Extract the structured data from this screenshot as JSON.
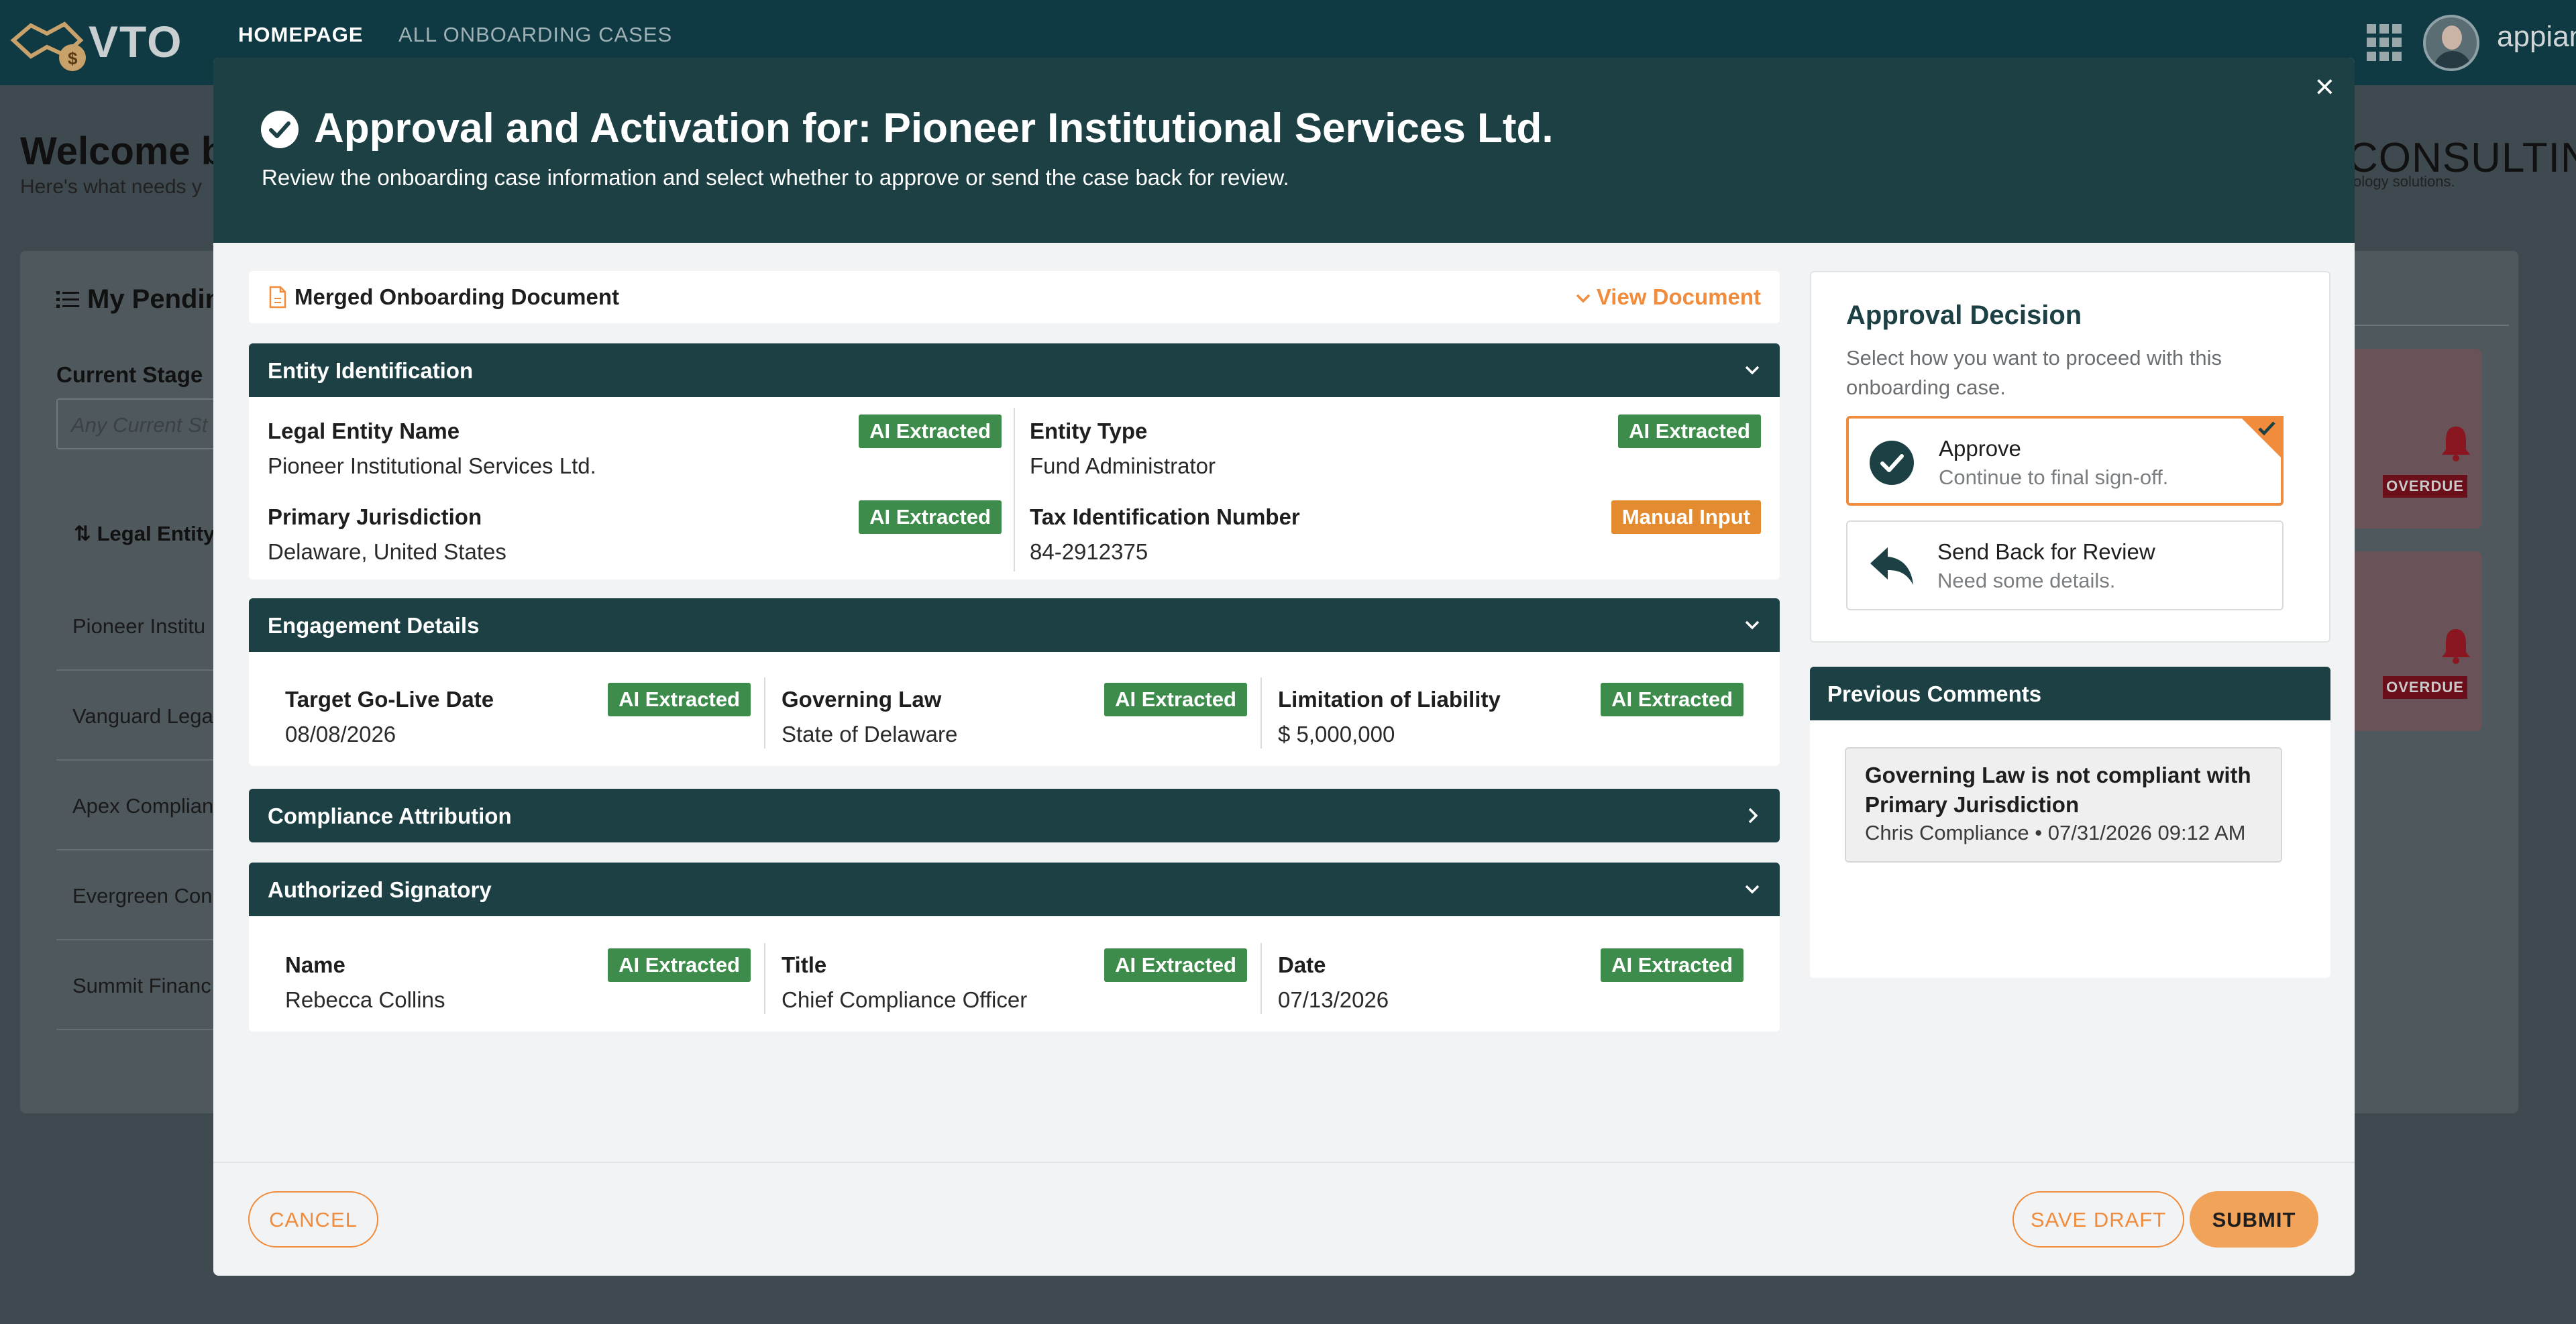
{
  "app": {
    "logo_text": "VTO",
    "nav": {
      "home": "HOMEPAGE",
      "cases": "ALL ONBOARDING CASES"
    },
    "brand": "appian"
  },
  "background_page": {
    "welcome": "Welcome b",
    "subtitle": "Here's what needs y",
    "consulting": "CONSULTING",
    "tagline": "ology solutions.",
    "pending_title": "My Pendin",
    "current_stage_label": "Current Stage",
    "current_stage_placeholder": "Any Current St",
    "column_header": "Legal Entity",
    "rows": [
      "Pioneer Institu",
      "Vanguard Lega",
      "Apex Complian",
      "Evergreen Con",
      "Summit Financ"
    ],
    "overdue_label": "OVERDUE"
  },
  "modal": {
    "close": "×",
    "title": "Approval and Activation for: Pioneer Institutional Services Ltd.",
    "subtitle": "Review the onboarding case information and select whether to approve or send the case back for review.",
    "document": {
      "title": "Merged Onboarding Document",
      "view_label": "View Document"
    },
    "tags": {
      "ai": "AI Extracted",
      "manual": "Manual Input"
    },
    "entity_identification": {
      "title": "Entity Identification",
      "fields": [
        {
          "label": "Legal Entity Name",
          "value": "Pioneer Institutional Services Ltd.",
          "tag": "AI Extracted"
        },
        {
          "label": "Entity Type",
          "value": "Fund Administrator",
          "tag": "AI Extracted"
        },
        {
          "label": "Primary Jurisdiction",
          "value": "Delaware, United States",
          "tag": "AI Extracted"
        },
        {
          "label": "Tax Identification Number",
          "value": "84-2912375",
          "tag": "Manual Input"
        }
      ]
    },
    "engagement_details": {
      "title": "Engagement Details",
      "fields": [
        {
          "label": "Target Go-Live Date",
          "value": "08/08/2026",
          "tag": "AI Extracted"
        },
        {
          "label": "Governing Law",
          "value": "State of Delaware",
          "tag": "AI Extracted"
        },
        {
          "label": "Limitation of Liability",
          "value": "$ 5,000,000",
          "tag": "AI Extracted"
        }
      ]
    },
    "compliance_attribution": {
      "title": "Compliance Attribution"
    },
    "authorized_signatory": {
      "title": "Authorized Signatory",
      "fields": [
        {
          "label": "Name",
          "value": "Rebecca Collins",
          "tag": "AI Extracted"
        },
        {
          "label": "Title",
          "value": "Chief Compliance Officer",
          "tag": "AI Extracted"
        },
        {
          "label": "Date",
          "value": "07/13/2026",
          "tag": "AI Extracted"
        }
      ]
    },
    "approval_decision": {
      "title": "Approval Decision",
      "description": "Select how you want to proceed with this onboarding case.",
      "options": [
        {
          "title": "Approve",
          "description": "Continue to final sign-off.",
          "selected": true
        },
        {
          "title": "Send Back for Review",
          "description": "Need some details.",
          "selected": false
        }
      ]
    },
    "previous_comments": {
      "title": "Previous Comments",
      "items": [
        {
          "text": "Governing Law is not compliant with Primary Jurisdiction",
          "meta": "Chris Compliance • 07/31/2026 09:12 AM"
        }
      ]
    },
    "buttons": {
      "cancel": "CANCEL",
      "save_draft": "SAVE DRAFT",
      "submit": "SUBMIT"
    }
  },
  "colors": {
    "header": "#0f3a44",
    "modal_header": "#1c4043",
    "accent": "#f08c3c",
    "ai_tag": "#3e8c4c",
    "manual_tag": "#e58b2f"
  },
  "icons": [
    "vto-logo-icon",
    "grid-icon",
    "avatar",
    "check-circle-icon",
    "document-icon",
    "chevron-down-icon",
    "chevron-right-icon",
    "reply-arrow-icon",
    "bell-icon",
    "list-icon",
    "sort-icon",
    "close-icon"
  ]
}
